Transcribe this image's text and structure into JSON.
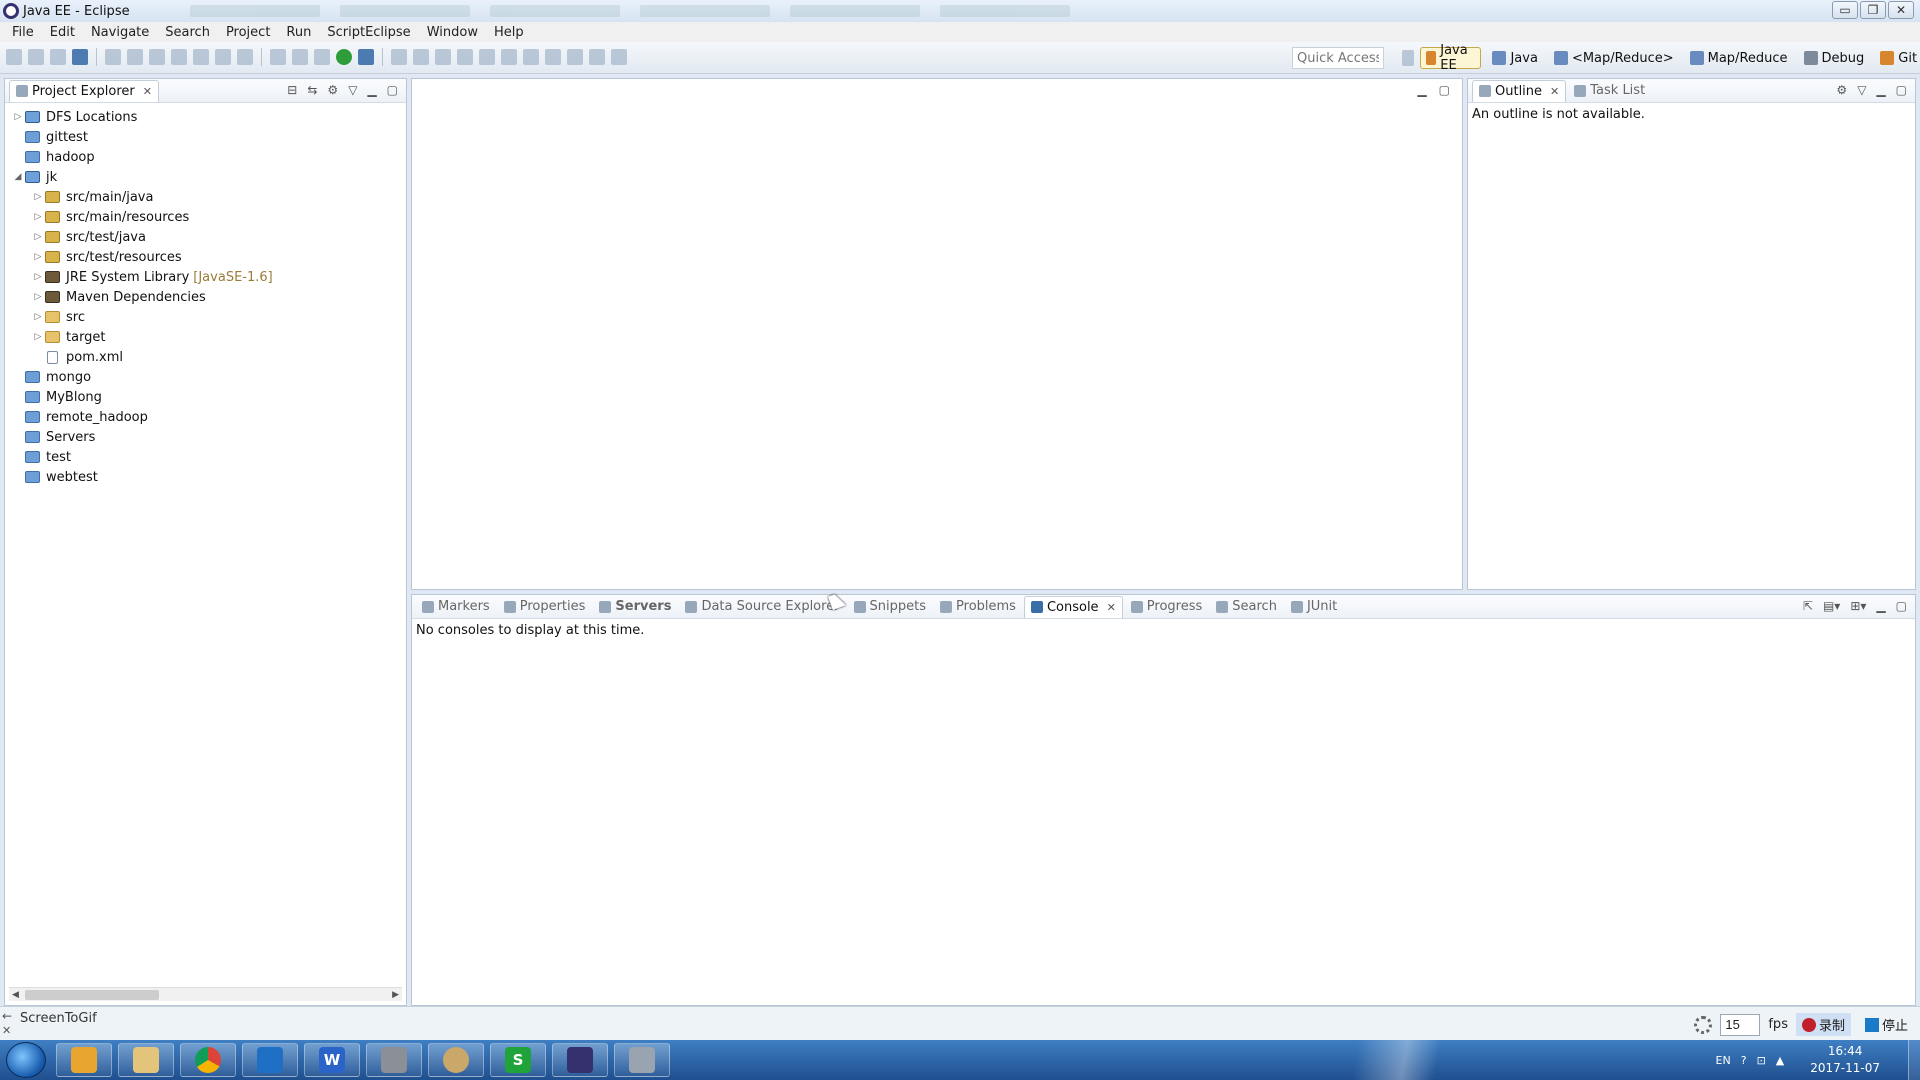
{
  "window": {
    "title": "Java EE - Eclipse",
    "controls": [
      "▭",
      "❐",
      "✕"
    ]
  },
  "menu": [
    "File",
    "Edit",
    "Navigate",
    "Search",
    "Project",
    "Run",
    "ScriptEclipse",
    "Window",
    "Help"
  ],
  "toolbar": {
    "quick_access_placeholder": "Quick Access",
    "perspectives": [
      {
        "label": "Java EE",
        "icon": "java-ee-icon",
        "active": true
      },
      {
        "label": "Java",
        "icon": "java-icon",
        "active": false
      },
      {
        "label": "<Map/Reduce>",
        "icon": "elephant-icon",
        "active": false
      },
      {
        "label": "Map/Reduce",
        "icon": "elephant-icon",
        "active": false
      },
      {
        "label": "Debug",
        "icon": "bug-icon",
        "active": false
      },
      {
        "label": "Git",
        "icon": "git-icon",
        "active": false
      }
    ]
  },
  "project_explorer": {
    "tab_label": "Project Explorer",
    "tree": [
      {
        "label": "DFS Locations",
        "depth": 0,
        "twisty": "▷",
        "icon": "dfs-icon"
      },
      {
        "label": "gittest",
        "depth": 0,
        "twisty": "",
        "icon": "folder-blue"
      },
      {
        "label": "hadoop",
        "depth": 0,
        "twisty": "",
        "icon": "folder-blue"
      },
      {
        "label": "jk",
        "depth": 0,
        "twisty": "◢",
        "icon": "project-icon"
      },
      {
        "label": "src/main/java",
        "depth": 1,
        "twisty": "▷",
        "icon": "package-folder-icon"
      },
      {
        "label": "src/main/resources",
        "depth": 1,
        "twisty": "▷",
        "icon": "package-folder-icon"
      },
      {
        "label": "src/test/java",
        "depth": 1,
        "twisty": "▷",
        "icon": "package-folder-icon"
      },
      {
        "label": "src/test/resources",
        "depth": 1,
        "twisty": "▷",
        "icon": "package-folder-icon"
      },
      {
        "label": "JRE System Library",
        "decoration": "[JavaSE-1.6]",
        "depth": 1,
        "twisty": "▷",
        "icon": "library-icon"
      },
      {
        "label": "Maven Dependencies",
        "depth": 1,
        "twisty": "▷",
        "icon": "library-icon"
      },
      {
        "label": "src",
        "depth": 1,
        "twisty": "▷",
        "icon": "folder-yellow"
      },
      {
        "label": "target",
        "depth": 1,
        "twisty": "▷",
        "icon": "folder-yellow"
      },
      {
        "label": "pom.xml",
        "depth": 1,
        "twisty": "",
        "icon": "xml-file-icon"
      },
      {
        "label": "mongo",
        "depth": 0,
        "twisty": "",
        "icon": "folder-blue"
      },
      {
        "label": "MyBlong",
        "depth": 0,
        "twisty": "",
        "icon": "folder-blue"
      },
      {
        "label": "remote_hadoop",
        "depth": 0,
        "twisty": "",
        "icon": "folder-blue"
      },
      {
        "label": "Servers",
        "depth": 0,
        "twisty": "",
        "icon": "folder-blue"
      },
      {
        "label": "test",
        "depth": 0,
        "twisty": "",
        "icon": "folder-blue"
      },
      {
        "label": "webtest",
        "depth": 0,
        "twisty": "",
        "icon": "folder-blue"
      }
    ]
  },
  "outline": {
    "tabs": [
      {
        "label": "Outline",
        "active": true
      },
      {
        "label": "Task List",
        "active": false
      }
    ],
    "message": "An outline is not available."
  },
  "console": {
    "tabs": [
      {
        "label": "Markers",
        "active": false
      },
      {
        "label": "Properties",
        "active": false
      },
      {
        "label": "Servers",
        "active": false
      },
      {
        "label": "Data Source Explorer",
        "active": false
      },
      {
        "label": "Snippets",
        "active": false
      },
      {
        "label": "Problems",
        "active": false
      },
      {
        "label": "Console",
        "active": true
      },
      {
        "label": "Progress",
        "active": false
      },
      {
        "label": "Search",
        "active": false
      },
      {
        "label": "JUnit",
        "active": false
      }
    ],
    "message": "No consoles to display at this time."
  },
  "screentogif": {
    "label": "ScreenToGif",
    "fps_value": "15",
    "fps_label": "fps",
    "record_label": "录制",
    "stop_label": "停止"
  },
  "taskbar": {
    "apps": [
      "files-icon",
      "chrome-icon",
      "notepad-icon",
      "word-icon",
      "printer-icon",
      "paint-icon",
      "wechat-icon",
      "eclipse-icon",
      "remote-desktop-icon"
    ],
    "tray_lang": "EN",
    "clock_time": "16:44",
    "clock_date": "2017-11-07"
  }
}
